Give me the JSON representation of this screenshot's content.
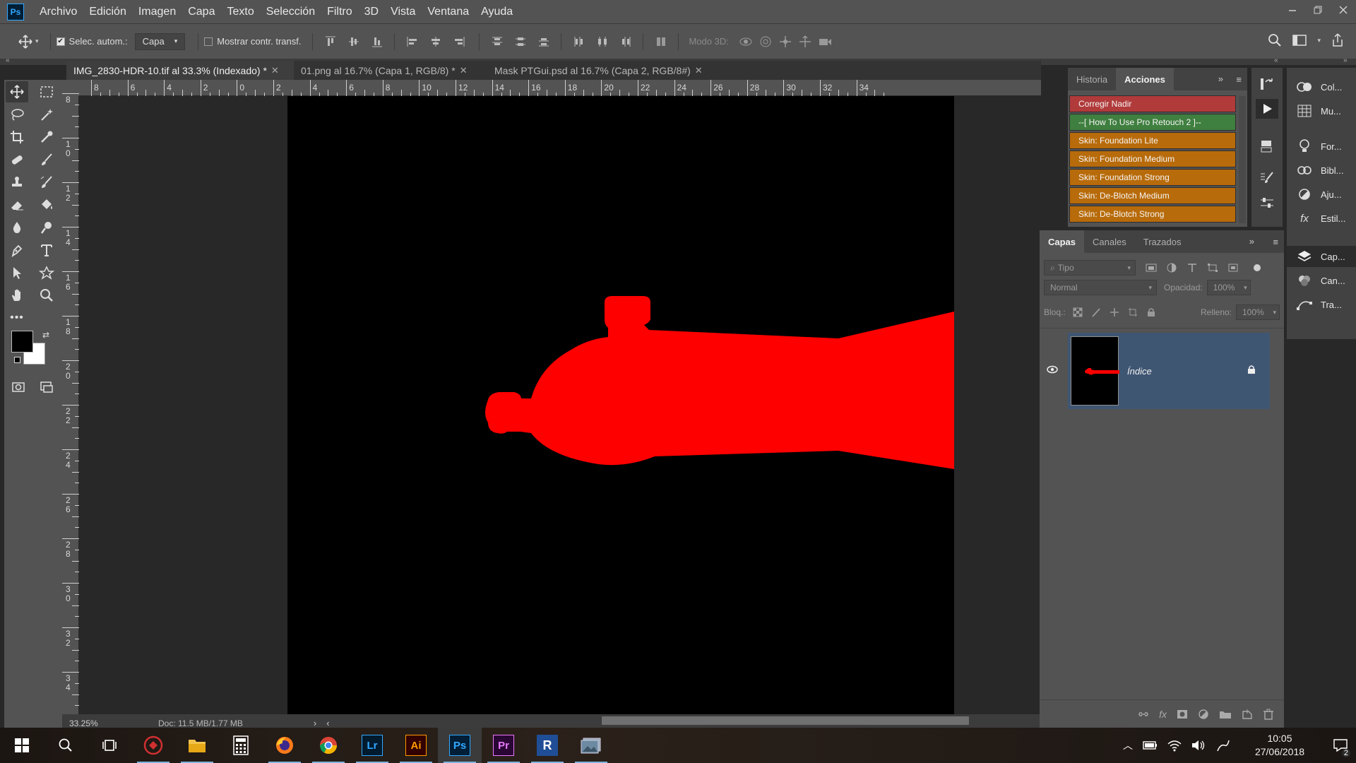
{
  "app": {
    "logo_text": "Ps",
    "menu": [
      "Archivo",
      "Edición",
      "Imagen",
      "Capa",
      "Texto",
      "Selección",
      "Filtro",
      "3D",
      "Vista",
      "Ventana",
      "Ayuda"
    ]
  },
  "options_bar": {
    "auto_select_label": "Selec. autom.:",
    "auto_select_checked": true,
    "auto_select_target": "Capa",
    "show_transform_label": "Mostrar contr. transf.",
    "show_transform_checked": false,
    "mode_3d_label": "Modo 3D:"
  },
  "tabs": [
    {
      "label": "IMG_2830-HDR-10.tif al 33.3% (Indexado) *",
      "active": true
    },
    {
      "label": "01.png al 16.7% (Capa 1, RGB/8) *",
      "active": false
    },
    {
      "label": "Mask PTGui.psd al 16.7% (Capa 2, RGB/8#)",
      "active": false
    }
  ],
  "rulers": {
    "top": [
      "8",
      "6",
      "4",
      "2",
      "0",
      "2",
      "4",
      "6",
      "8",
      "10",
      "12",
      "14",
      "16",
      "18",
      "20",
      "22",
      "24",
      "26",
      "28",
      "30",
      "32",
      "34"
    ],
    "left": [
      "8",
      "1 0",
      "1 2",
      "1 4",
      "1 6",
      "1 8",
      "2 0",
      "2 2",
      "2 4",
      "2 6",
      "2 8",
      "3 0",
      "3 2",
      "3 4"
    ]
  },
  "status": {
    "zoom": "33.25%",
    "doc_size": "Doc: 11.5 MB/1.77 MB"
  },
  "actions_panel": {
    "tabs": [
      "Historia",
      "Acciones"
    ],
    "active_tab": "Acciones",
    "items": [
      {
        "label": "Corregir Nadir",
        "color": "#b13a3a"
      },
      {
        "label": "--[ How To Use Pro Retouch 2 ]--",
        "color": "#3f7f3f"
      },
      {
        "label": "Skin: Foundation Lite",
        "color": "#b86b0a"
      },
      {
        "label": "Skin: Foundation Medium",
        "color": "#b86b0a"
      },
      {
        "label": "Skin: Foundation Strong",
        "color": "#b86b0a"
      },
      {
        "label": "Skin: De-Blotch Medium",
        "color": "#b86b0a"
      },
      {
        "label": "Skin: De-Blotch Strong",
        "color": "#b86b0a"
      }
    ]
  },
  "side_panels": {
    "items": [
      "Col...",
      "Mu...",
      "For...",
      "Bibl...",
      "Aju...",
      "Estil...",
      "Cap...",
      "Can...",
      "Tra..."
    ]
  },
  "layers_panel": {
    "tabs": [
      "Capas",
      "Canales",
      "Trazados"
    ],
    "active_tab": "Capas",
    "filter_placeholder": "Tipo",
    "blend_mode": "Normal",
    "opacity_label": "Opacidad:",
    "opacity_value": "100%",
    "lock_label": "Bloq.:",
    "fill_label": "Relleno:",
    "fill_value": "100%",
    "layers": [
      {
        "name": "Índice",
        "visible": true,
        "locked": true
      }
    ]
  },
  "taskbar": {
    "apps": [
      {
        "name": "Lr",
        "color": "#31a8ff",
        "bg": "#001a2e"
      },
      {
        "name": "Ai",
        "color": "#ff9a00",
        "bg": "#330000"
      },
      {
        "name": "Ps",
        "color": "#31a8ff",
        "bg": "#001e36"
      },
      {
        "name": "Pr",
        "color": "#ea77ff",
        "bg": "#2a0634"
      },
      {
        "name": "R",
        "color": "#ffffff",
        "bg": "#1f4e96"
      }
    ],
    "time": "10:05",
    "date": "27/06/2018",
    "notifications": "2"
  },
  "colors": {
    "mask_red": "#ff0000",
    "canvas_bg": "#000000",
    "selected_layer": "#3f5673",
    "accent": "#31a8ff"
  }
}
